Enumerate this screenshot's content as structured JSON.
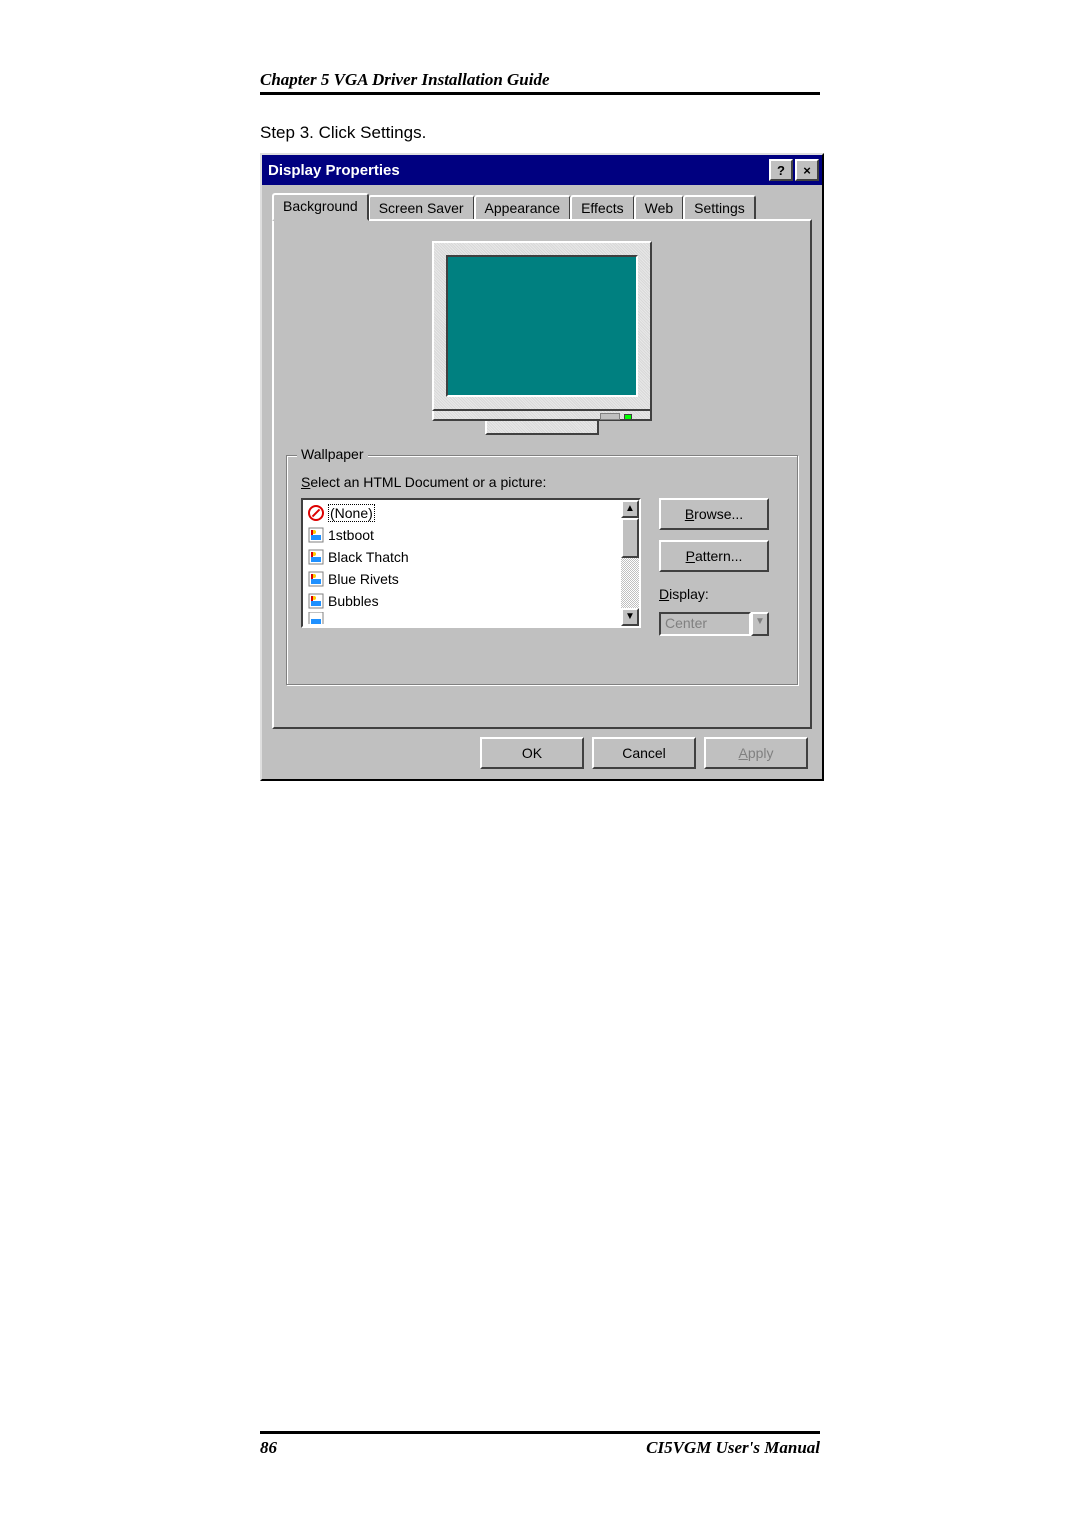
{
  "chapter_header": "Chapter 5  VGA Driver Installation Guide",
  "step_text": "Step 3.  Click Settings.",
  "dialog": {
    "title": "Display Properties",
    "tabs": [
      "Background",
      "Screen Saver",
      "Appearance",
      "Effects",
      "Web",
      "Settings"
    ],
    "active_tab": 0,
    "wallpaper": {
      "group_label": "Wallpaper",
      "select_label": "Select an HTML Document or a picture:",
      "items": [
        "(None)",
        "1stboot",
        "Black Thatch",
        "Blue Rivets",
        "Bubbles"
      ],
      "selected": 0,
      "browse": "Browse...",
      "pattern": "Pattern...",
      "display_label": "Display:",
      "display_value": "Center"
    },
    "buttons": {
      "ok": "OK",
      "cancel": "Cancel",
      "apply": "Apply"
    }
  },
  "footer": {
    "page": "86",
    "manual": "CI5VGM User's Manual"
  }
}
